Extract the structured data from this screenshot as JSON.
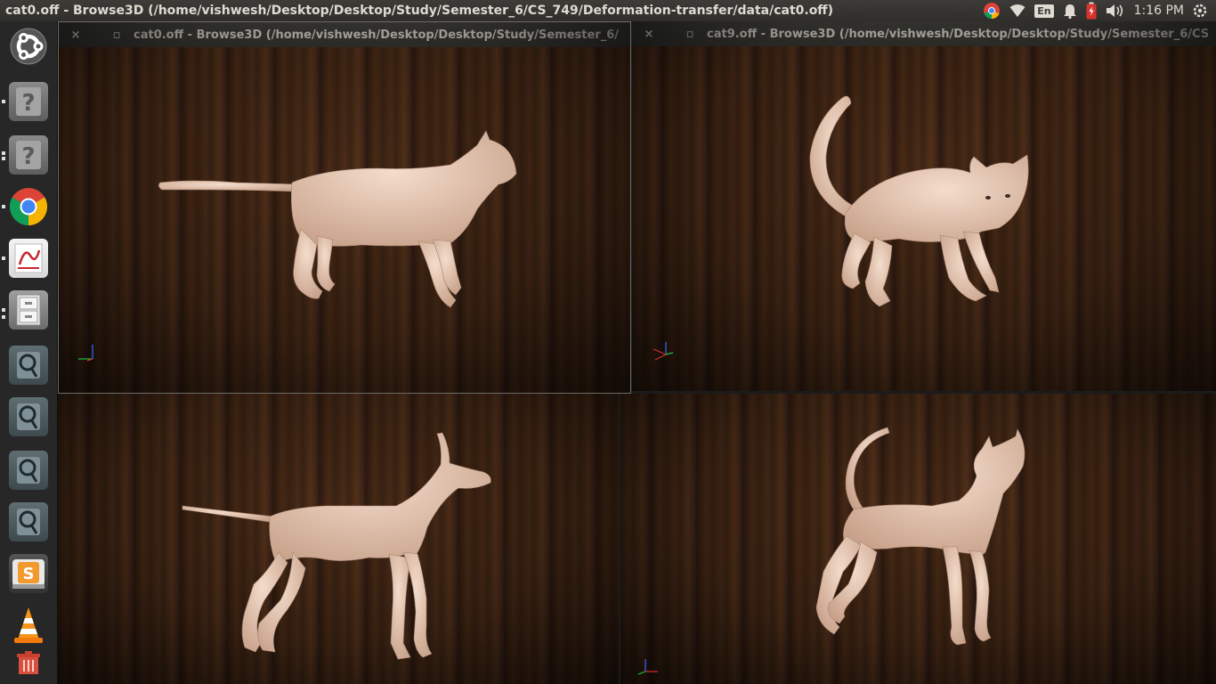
{
  "top_panel": {
    "title": "cat0.off - Browse3D (/home/vishwesh/Desktop/Desktop/Study/Semester_6/CS_749/Deformation-transfer/data/cat0.off)",
    "clock": "1:16 PM",
    "keyboard_layout": "En",
    "tray_icons": [
      "chrome-icon",
      "wifi-icon",
      "keyboard-layout-indicator",
      "notification-bell-icon",
      "battery-icon",
      "volume-icon"
    ]
  },
  "launcher": {
    "items": [
      "ubuntu-dash",
      "unknown-app",
      "unknown-app",
      "google-chrome",
      "document-viewer",
      "file-manager",
      "browse3d",
      "browse3d",
      "browse3d",
      "browse3d",
      "sublime-text",
      "vlc",
      "trash"
    ]
  },
  "windows": [
    {
      "title": "cat0.off - Browse3D (/home/vishwesh/Desktop/Desktop/Study/Semester_6/",
      "close": "×",
      "maximize": "▫",
      "model": "cat-standing-side"
    },
    {
      "title": "cat9.off - Browse3D (/home/vishwesh/Desktop/Desktop/Study/Semester_6/CS",
      "close": "×",
      "maximize": "▫",
      "model": "cat-tail-up"
    },
    {
      "model": "dog-standing-side"
    },
    {
      "model": "dog-tail-up"
    }
  ],
  "colors": {
    "panel": "#3c3b37",
    "mesh": "#e9c9b3",
    "wood": "#4b2c18"
  }
}
